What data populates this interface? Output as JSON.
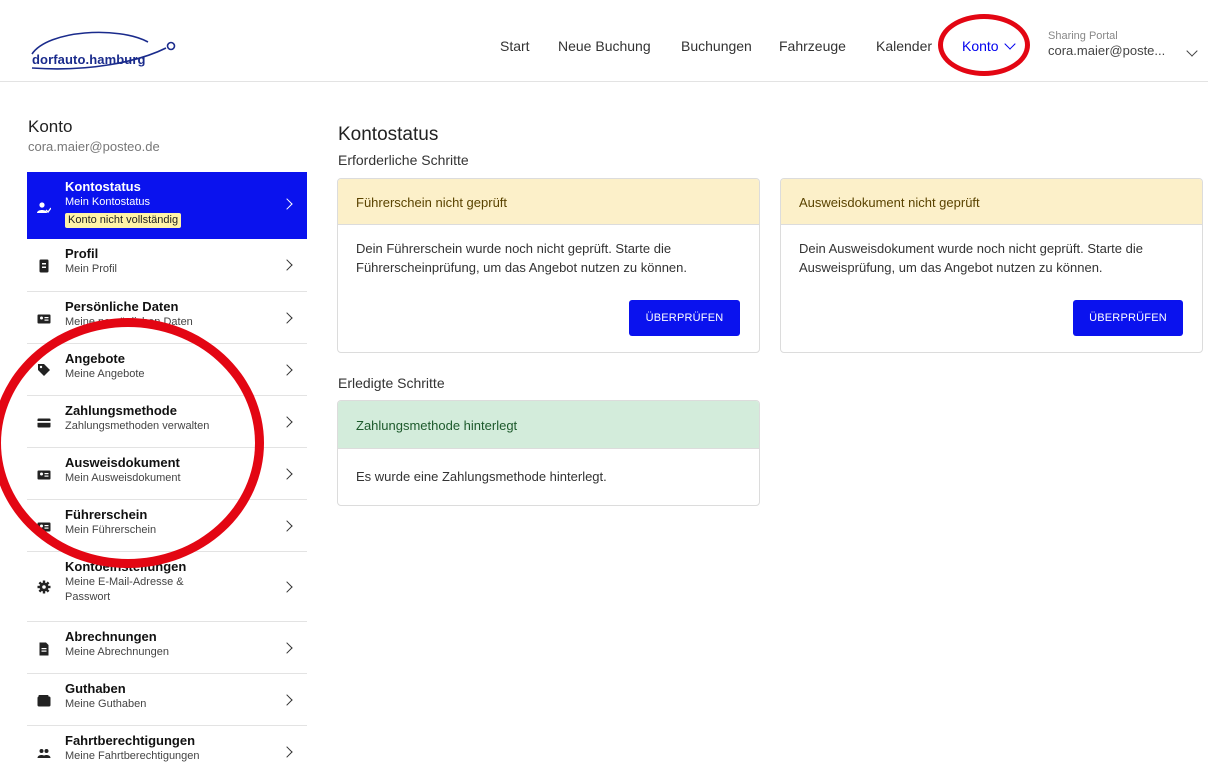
{
  "brand": {
    "logo_text": "dorfauto.hamburg",
    "accent": "#0a12ee"
  },
  "nav": {
    "items": [
      "Start",
      "Neue Buchung",
      "Buchungen",
      "Fahrzeuge",
      "Kalender"
    ],
    "konto": "Konto"
  },
  "user": {
    "portal": "Sharing Portal",
    "email": "cora.maier@poste..."
  },
  "sidebar": {
    "title": "Konto",
    "email": "cora.maier@posteo.de",
    "items": [
      {
        "label": "Kontostatus",
        "sub": "Mein Kontostatus",
        "badge": "Konto nicht vollständig",
        "icon": "person-check-icon"
      },
      {
        "label": "Profil",
        "sub": "Mein Profil",
        "icon": "id-badge-icon"
      },
      {
        "label": "Persönliche Daten",
        "sub": "Meine persönlichen Daten",
        "icon": "id-card-icon"
      },
      {
        "label": "Angebote",
        "sub": "Meine Angebote",
        "icon": "tags-icon"
      },
      {
        "label": "Zahlungsmethode",
        "sub": "Zahlungsmethoden verwalten",
        "icon": "credit-card-icon"
      },
      {
        "label": "Ausweisdokument",
        "sub": "Mein Ausweisdokument",
        "icon": "id-card-icon"
      },
      {
        "label": "Führerschein",
        "sub": "Mein Führerschein",
        "icon": "id-card-icon"
      },
      {
        "label": "Kontoeinstellungen",
        "sub": "Meine E-Mail-Adresse & Passwort",
        "icon": "gear-icon"
      },
      {
        "label": "Abrechnungen",
        "sub": "Meine Abrechnungen",
        "icon": "invoice-icon"
      },
      {
        "label": "Guthaben",
        "sub": "Meine Guthaben",
        "icon": "wallet-icon"
      },
      {
        "label": "Fahrtberechtigungen",
        "sub": "Meine Fahrtberechtigungen",
        "icon": "users-icon"
      }
    ]
  },
  "main": {
    "title": "Kontostatus",
    "required_label": "Erforderliche Schritte",
    "done_label": "Erledigte Schritte",
    "cards": {
      "license": {
        "head": "Führerschein nicht geprüft",
        "body": "Dein Führerschein wurde noch nicht geprüft. Starte die Führerscheinprüfung, um das Angebot nutzen zu können.",
        "button": "ÜBERPRÜFEN"
      },
      "id": {
        "head": "Ausweisdokument nicht geprüft",
        "body": "Dein Ausweisdokument wurde noch nicht geprüft. Starte die Ausweisprüfung, um das Angebot nutzen zu können.",
        "button": "ÜBERPRÜFEN"
      },
      "payment": {
        "head": "Zahlungsmethode hinterlegt",
        "body": "Es wurde eine Zahlungsmethode hinterlegt."
      }
    }
  }
}
